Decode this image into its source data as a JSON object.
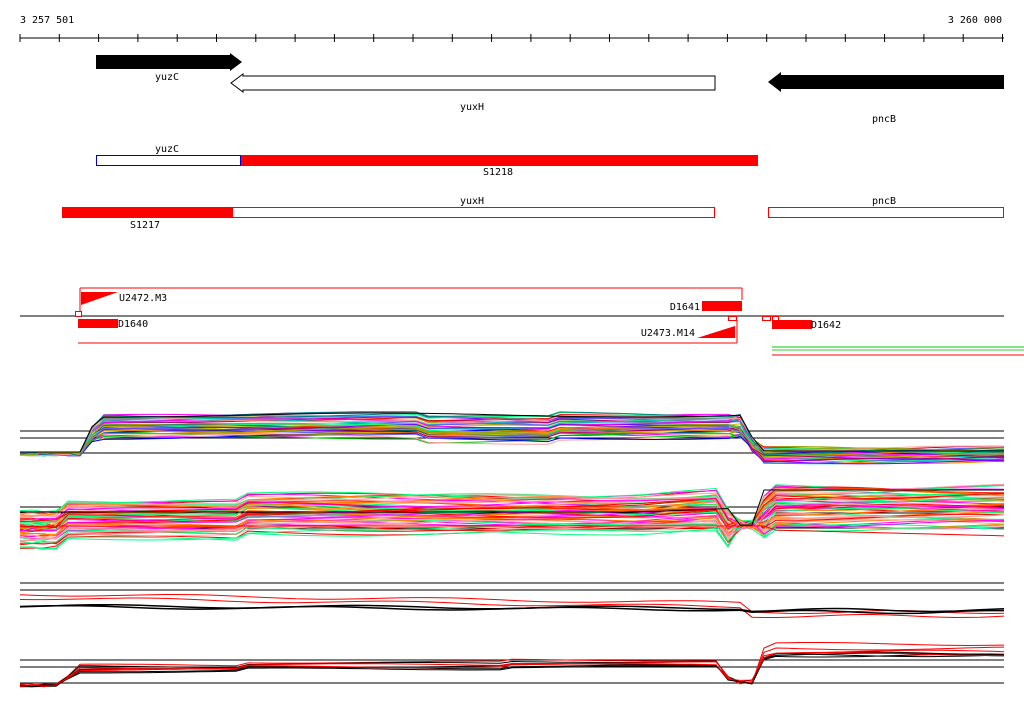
{
  "ruler": {
    "start_label": "3 257 501",
    "end_label": "3 260 000"
  },
  "genes": {
    "yuzC": "yuzC",
    "yuxH": "yuxH",
    "pncB": "pncB"
  },
  "segments": {
    "yuzC": "yuzC",
    "S1218": "S1218",
    "yuxH": "yuxH",
    "S1217": "S1217",
    "pncB": "pncB"
  },
  "features": {
    "U2472_M3": "U2472.M3",
    "D1640": "D1640",
    "D1641": "D1641",
    "U2473_M14": "U2473.M14",
    "D1642": "D1642"
  },
  "colors": {
    "feature_red": "#ff0000",
    "gene_black": "#000000",
    "outline_blue": "#0000cc",
    "profile_palette": [
      "#ff0000",
      "#00c000",
      "#0000ff",
      "#ff00ff",
      "#00c0c0",
      "#c0c000",
      "#ff8000",
      "#8000ff",
      "#808080",
      "#00ff80",
      "#c00060",
      "#6060ff",
      "#ffa0a0",
      "#008080",
      "#a0a000"
    ]
  },
  "profile_panels": [
    {
      "name": "profile-panel-1",
      "kind": "multicolor",
      "count": 45
    },
    {
      "name": "profile-panel-2",
      "kind": "multicolor",
      "count": 55
    },
    {
      "name": "profile-panel-3",
      "kind": "red-black",
      "count": 4
    },
    {
      "name": "profile-panel-4",
      "kind": "red-black",
      "count": 8
    }
  ]
}
